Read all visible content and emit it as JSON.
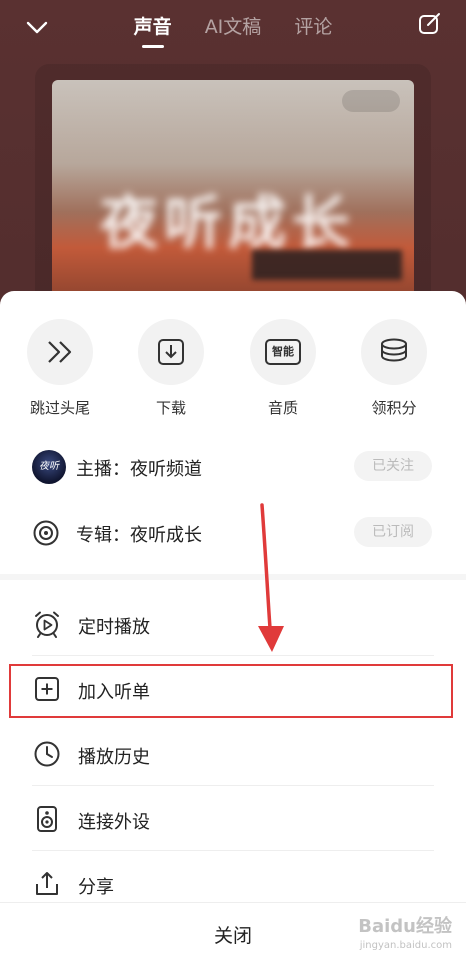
{
  "header": {
    "tabs": [
      {
        "label": "声音",
        "active": true
      },
      {
        "label": "AI文稿",
        "active": false
      },
      {
        "label": "评论",
        "active": false
      }
    ]
  },
  "cover": {
    "title_blurred": "夜听成长",
    "subtitle_blurred": "夜听"
  },
  "quick_actions": [
    {
      "label": "跳过头尾",
      "icon": "skip-forward-icon"
    },
    {
      "label": "下载",
      "icon": "download-icon"
    },
    {
      "label": "音质",
      "icon": "hq-badge-icon",
      "badge_text": "智能"
    },
    {
      "label": "领积分",
      "icon": "coin-stack-icon"
    }
  ],
  "anchor": {
    "text": "主播：夜听频道",
    "avatar_text": "夜听",
    "status": "已关注"
  },
  "album": {
    "text": "专辑：夜听成长",
    "status": "已订阅"
  },
  "menu": [
    {
      "label": "定时播放",
      "icon": "alarm-clock-icon"
    },
    {
      "label": "加入听单",
      "icon": "add-square-icon"
    },
    {
      "label": "播放历史",
      "icon": "clock-icon"
    },
    {
      "label": "连接外设",
      "icon": "speaker-icon"
    },
    {
      "label": "分享",
      "icon": "share-icon"
    }
  ],
  "close_label": "关闭",
  "watermark": {
    "text": "Baidu经验",
    "sub": "jingyan.baidu.com"
  },
  "colors": {
    "highlight": "#e03a3a",
    "arrow": "#e03a3a",
    "pill_text": "#bbbbbb"
  }
}
